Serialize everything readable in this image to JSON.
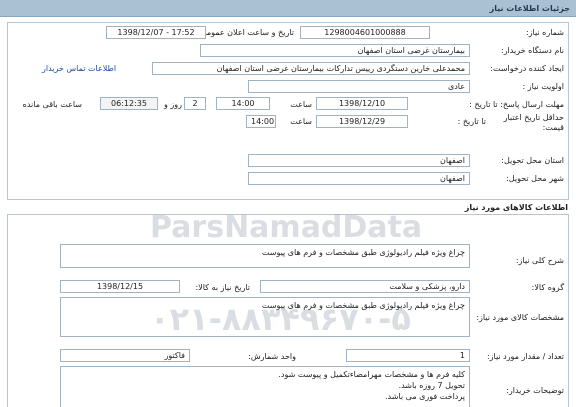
{
  "header": {
    "title": "جزئیات اطلاعات نیاز"
  },
  "need_info": {
    "need_number_label": "شماره نیاز:",
    "need_number": "1298004601000888",
    "announce_label": "تاریخ و ساعت اعلان عمومی:",
    "announce_value": "1398/12/07 - 17:52",
    "buyer_org_label": "نام دستگاه خریدار:",
    "buyer_org": "بیمارستان غرضی استان اصفهان",
    "requester_label": "ایجاد کننده درخواست:",
    "requester": "محمدعلی خارین دستگردی رییس تدارکات بیمارستان غرضی استان اصفهان",
    "contact_link": "اطلاعات تماس خریدار",
    "priority_label": "اولویت نیاز :",
    "priority": "عادی",
    "reply_deadline_label": "مهلت ارسال پاسخ: تا تاریخ :",
    "reply_date": "1398/12/10",
    "time_label": "ساعت",
    "reply_time": "14:00",
    "days_value": "2",
    "days_label": "روز و",
    "remaining_time": "06:12:35",
    "remaining_label": "ساعت باقی مانده",
    "price_validity_label": "حداقل تاریخ اعتبار قیمت:",
    "price_validity_to": "تا تاریخ :",
    "price_date": "1398/12/29",
    "price_time": "14:00",
    "province_label": "استان محل تحویل:",
    "province": "اصفهان",
    "city_label": "شهر محل تحویل:",
    "city": "اصفهان"
  },
  "goods": {
    "section_title": "اطلاعات کالاهای مورد نیاز",
    "general_desc_label": "شرح کلی نیاز:",
    "general_desc": "چراغ ویژه فیلم رادیولوژی طبق مشخصات و فرم های پیوست",
    "group_label": "گروه کالا:",
    "group": "دارو، پزشکی و سلامت",
    "need_date_label": "تاریخ نیاز به کالا:",
    "need_date": "1398/12/15",
    "spec_label": "مشخصات کالای مورد نیاز:",
    "spec": "چراغ ویژه فیلم رادیولوژی طبق مشخصات و فرم های پیوست",
    "quantity_label": "تعداد / مقدار مورد نیاز:",
    "quantity": "1",
    "unit_label": "واحد شمارش:",
    "unit": "فاکتور",
    "buyer_notes_label": "توضیحات خریدار:",
    "buyer_notes_1": "کلیه فرم ها و مشخصات مهرامضاءتکمیل و پیوست شود.",
    "buyer_notes_2": "تحویل 7 روزه باشد.",
    "buyer_notes_3": "پرداخت فوری می باشد."
  },
  "watermark": {
    "brand": "ParsNamadData",
    "phone": "۰۲۱-۸۸۳۴۹۶۷۰-۵"
  }
}
